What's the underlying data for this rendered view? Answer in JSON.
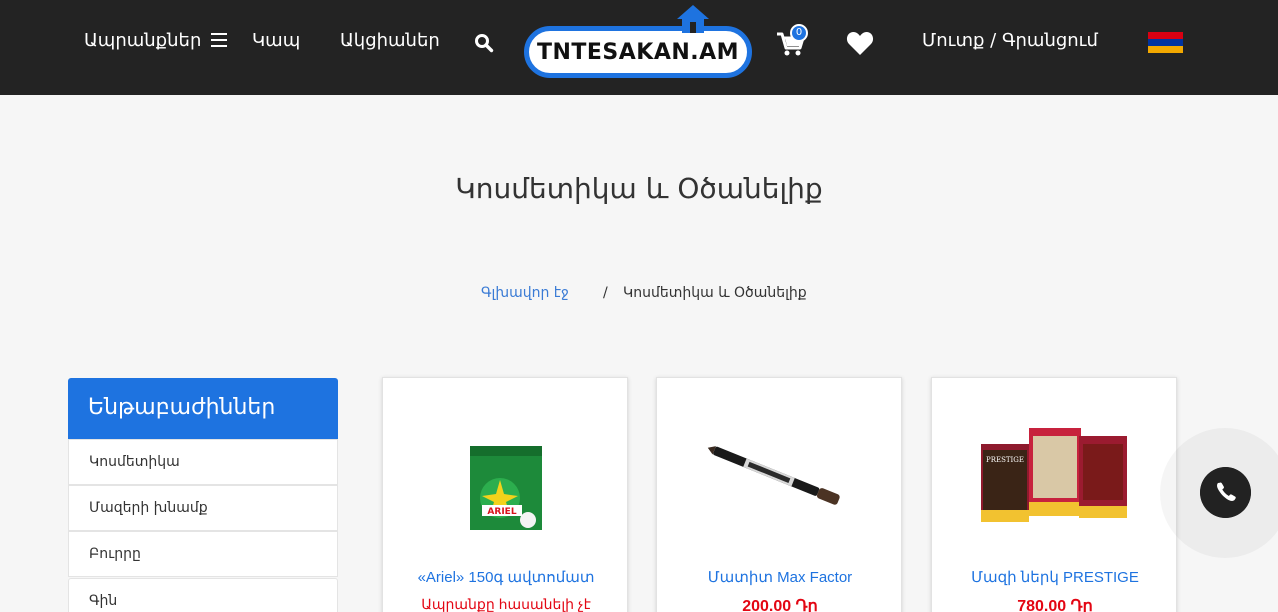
{
  "header": {
    "products_label": "Ապրանքներ",
    "contact_label": "Կապ",
    "promotions_label": "Ակցիաներ",
    "logo_text": "TNTESAKAN.AM",
    "cart_count": "0",
    "login_label": "Մուտք / Գրանցում",
    "language": "Armenian",
    "flag_colors": [
      "#d90012",
      "#0033a0",
      "#f2a800"
    ]
  },
  "page": {
    "title": "Կոսմետիկա և Օծանելիք"
  },
  "breadcrumb": {
    "home": "Գլխավոր էջ",
    "separator": "/",
    "current": "Կոսմետիկա և Օծանելիք"
  },
  "sidebar": {
    "heading": "Ենթաբաժիններ",
    "items": [
      {
        "label": "Կոսմետիկա"
      },
      {
        "label": "Մազերի խնամք"
      },
      {
        "label": "Բուրրը"
      },
      {
        "label": "Գին"
      }
    ]
  },
  "products": [
    {
      "name": "«Ariel» 150գ ավտոմատ",
      "status": "Ապրանքը հասանելի չէ",
      "image": "ariel-detergent-pack"
    },
    {
      "name": "Մատիտ Max Factor",
      "price": "200.00 Դր",
      "image": "eye-pencil"
    },
    {
      "name": "Մազի ներկ PRESTIGE",
      "price": "780.00 Դր",
      "image": "hair-dye-boxes"
    }
  ],
  "colors": {
    "header_bg": "#232323",
    "accent": "#1e73e0",
    "price": "#e30613",
    "page_bg": "#f6f6f6"
  }
}
